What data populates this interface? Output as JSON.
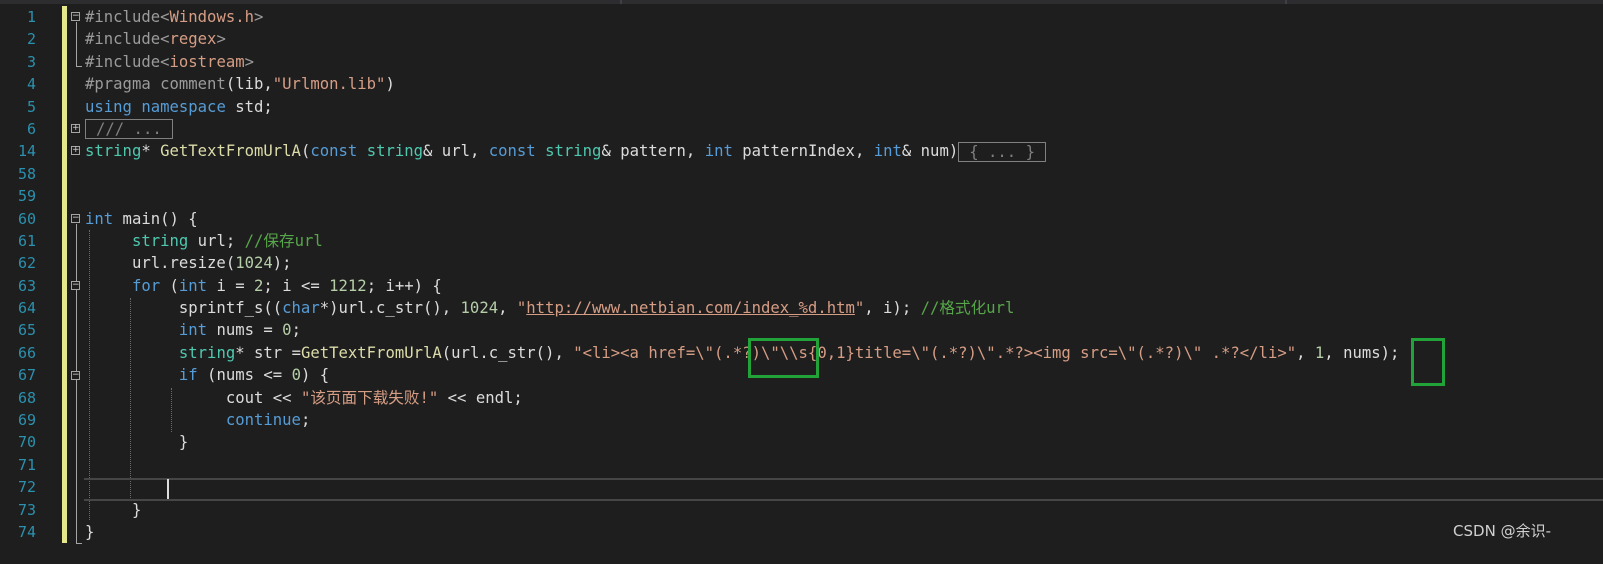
{
  "editor": {
    "line_numbers": [
      "1",
      "2",
      "3",
      "4",
      "5",
      "6",
      "14",
      "58",
      "59",
      "60",
      "61",
      "62",
      "63",
      "64",
      "65",
      "66",
      "67",
      "68",
      "69",
      "70",
      "71",
      "72",
      "73",
      "74"
    ],
    "lines": [
      [
        {
          "t": "#include<",
          "c": "pre"
        },
        {
          "t": "Windows.h",
          "c": "str"
        },
        {
          "t": ">",
          "c": "pre"
        }
      ],
      [
        {
          "t": "#include<",
          "c": "pre"
        },
        {
          "t": "regex",
          "c": "str"
        },
        {
          "t": ">",
          "c": "pre"
        }
      ],
      [
        {
          "t": "#include<",
          "c": "pre"
        },
        {
          "t": "iostream",
          "c": "str"
        },
        {
          "t": ">",
          "c": "pre"
        }
      ],
      [
        {
          "t": "#pragma comment",
          "c": "pre"
        },
        {
          "t": "(lib,",
          "c": ""
        },
        {
          "t": "\"Urlmon.lib\"",
          "c": "str"
        },
        {
          "t": ")",
          "c": ""
        }
      ],
      [
        {
          "t": "using",
          "c": "kw"
        },
        {
          "t": " ",
          "c": ""
        },
        {
          "t": "namespace",
          "c": "kw"
        },
        {
          "t": " std;",
          "c": ""
        }
      ],
      [
        {
          "t": "/// ...",
          "c": "collapsed"
        }
      ],
      [
        {
          "t": "string",
          "c": "ty"
        },
        {
          "t": "* ",
          "c": ""
        },
        {
          "t": "GetTextFromUrlA",
          "c": "fn"
        },
        {
          "t": "(",
          "c": ""
        },
        {
          "t": "const",
          "c": "kw"
        },
        {
          "t": " ",
          "c": ""
        },
        {
          "t": "string",
          "c": "ty"
        },
        {
          "t": "& url, ",
          "c": ""
        },
        {
          "t": "const",
          "c": "kw"
        },
        {
          "t": " ",
          "c": ""
        },
        {
          "t": "string",
          "c": "ty"
        },
        {
          "t": "& pattern, ",
          "c": ""
        },
        {
          "t": "int",
          "c": "kw"
        },
        {
          "t": " patternIndex, ",
          "c": ""
        },
        {
          "t": "int",
          "c": "kw"
        },
        {
          "t": "& num)",
          "c": ""
        },
        {
          "t": "{ ... }",
          "c": "collapsed"
        }
      ],
      [],
      [],
      [
        {
          "t": "int",
          "c": "kw"
        },
        {
          "t": " main() {",
          "c": ""
        }
      ],
      [
        {
          "t": "     ",
          "c": ""
        },
        {
          "t": "string",
          "c": "ty"
        },
        {
          "t": " url; ",
          "c": ""
        },
        {
          "t": "//保存url",
          "c": "cm"
        }
      ],
      [
        {
          "t": "     url.resize(",
          "c": ""
        },
        {
          "t": "1024",
          "c": "num"
        },
        {
          "t": ");",
          "c": ""
        }
      ],
      [
        {
          "t": "     ",
          "c": ""
        },
        {
          "t": "for",
          "c": "kw"
        },
        {
          "t": " (",
          "c": ""
        },
        {
          "t": "int",
          "c": "kw"
        },
        {
          "t": " i = ",
          "c": ""
        },
        {
          "t": "2",
          "c": "num"
        },
        {
          "t": "; i <= ",
          "c": ""
        },
        {
          "t": "1212",
          "c": "num"
        },
        {
          "t": "; i++) {",
          "c": ""
        }
      ],
      [
        {
          "t": "          sprintf_s((",
          "c": ""
        },
        {
          "t": "char",
          "c": "kw"
        },
        {
          "t": "*)url.c_str(), ",
          "c": ""
        },
        {
          "t": "1024",
          "c": "num"
        },
        {
          "t": ", ",
          "c": ""
        },
        {
          "t": "\"",
          "c": "str"
        },
        {
          "t": "http://www.netbian.com/index_%d.htm",
          "c": "str link"
        },
        {
          "t": "\"",
          "c": "str"
        },
        {
          "t": ", i); ",
          "c": ""
        },
        {
          "t": "//格式化url",
          "c": "cm"
        }
      ],
      [
        {
          "t": "          ",
          "c": ""
        },
        {
          "t": "int",
          "c": "kw"
        },
        {
          "t": " nums = ",
          "c": ""
        },
        {
          "t": "0",
          "c": "num"
        },
        {
          "t": ";",
          "c": ""
        }
      ],
      [
        {
          "t": "          ",
          "c": ""
        },
        {
          "t": "string",
          "c": "ty"
        },
        {
          "t": "* str =",
          "c": ""
        },
        {
          "t": "GetTextFromUrlA",
          "c": "fn"
        },
        {
          "t": "(url.c_str(), ",
          "c": ""
        },
        {
          "t": "\"<li><a href=\\\"(.*?)\\\"\\\\s{0,1}title=\\\"(.*?)\\\".*?><img src=\\\"(.*?)\\\" .*?</li>\"",
          "c": "str"
        },
        {
          "t": ", ",
          "c": ""
        },
        {
          "t": "1",
          "c": "num"
        },
        {
          "t": ", nums);",
          "c": ""
        }
      ],
      [
        {
          "t": "          ",
          "c": ""
        },
        {
          "t": "if",
          "c": "kw"
        },
        {
          "t": " (nums <= ",
          "c": ""
        },
        {
          "t": "0",
          "c": "num"
        },
        {
          "t": ") {",
          "c": ""
        }
      ],
      [
        {
          "t": "               cout << ",
          "c": ""
        },
        {
          "t": "\"该页面下载失败!\"",
          "c": "str"
        },
        {
          "t": " << endl;",
          "c": ""
        }
      ],
      [
        {
          "t": "               ",
          "c": ""
        },
        {
          "t": "continue",
          "c": "kw"
        },
        {
          "t": ";",
          "c": ""
        }
      ],
      [
        {
          "t": "          }",
          "c": ""
        }
      ],
      [],
      [],
      [
        {
          "t": "     }",
          "c": ""
        }
      ],
      [
        {
          "t": "}",
          "c": ""
        }
      ]
    ]
  },
  "watermark": "CSDN @余识-",
  "colors": {
    "background": "#1e1e1e",
    "line_number": "#2b91af",
    "keyword": "#569cd6",
    "type": "#4ec9b0",
    "string": "#d69d85",
    "comment": "#57a64a",
    "highlight_box": "#22a33a"
  }
}
